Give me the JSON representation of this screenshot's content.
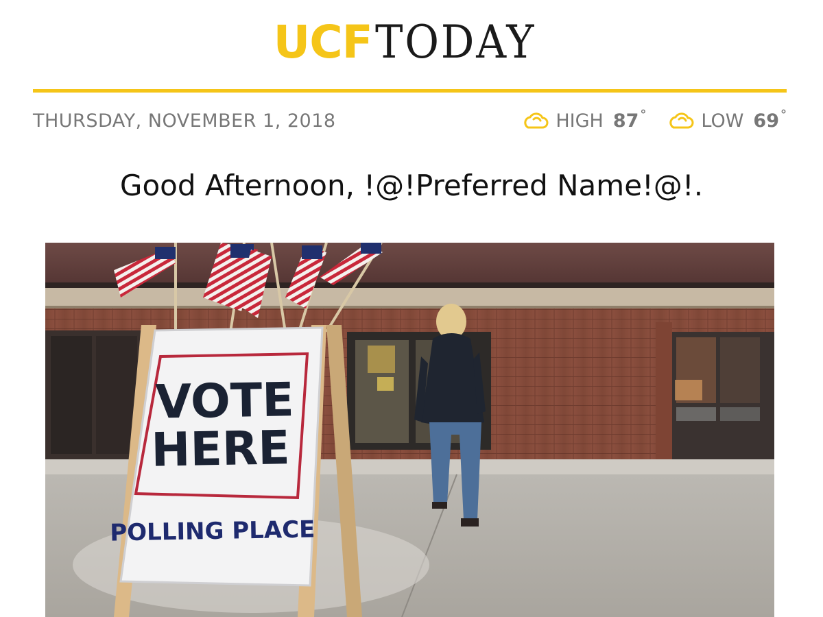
{
  "masthead": {
    "brand_primary": "UCF",
    "brand_secondary": "TODAY",
    "brand_primary_color": "#f5c518",
    "brand_secondary_color": "#1a1a1a",
    "rule_color": "#f5c518"
  },
  "infobar": {
    "date": "THURSDAY, NOVEMBER 1, 2018",
    "weather": {
      "high_label": "HIGH",
      "high_value": "87",
      "low_label": "LOW",
      "low_value": "69",
      "degree_symbol": "°",
      "icon": "cloud-icon",
      "icon_color": "#f5c518"
    }
  },
  "greeting": {
    "text": "Good Afternoon, !@!Preferred Name!@!."
  },
  "hero": {
    "sign": {
      "line1": "VOTE",
      "line2": "HERE",
      "line3": "POLLING PLACE"
    }
  }
}
